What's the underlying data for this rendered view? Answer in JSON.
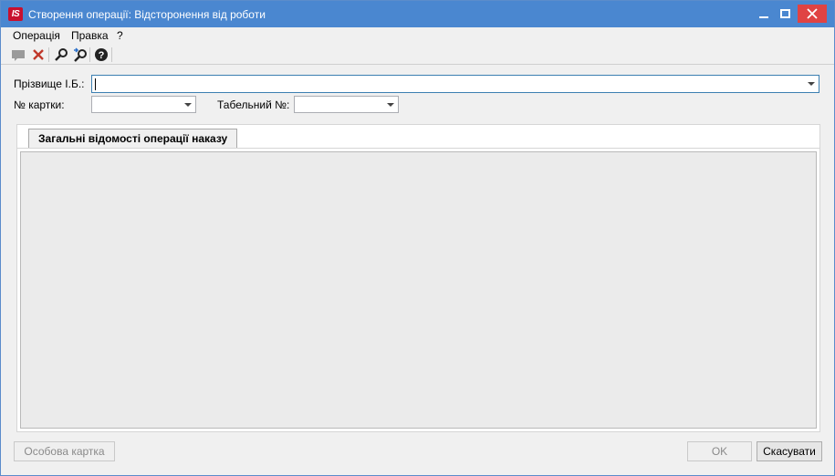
{
  "window": {
    "title": "Створення операції: Відсторонення від роботи",
    "logo_text": "IS",
    "accent_color": "#4a87d0",
    "close_color": "#e04343"
  },
  "menu": {
    "items": [
      {
        "label": "Операція"
      },
      {
        "label": "Правка"
      },
      {
        "label": "?"
      }
    ]
  },
  "toolbar": {
    "icons": [
      "message-icon",
      "delete-icon",
      "search-icon",
      "search-next-icon",
      "help-icon"
    ]
  },
  "form": {
    "name_label": "Прізвище І.Б.:",
    "name_value": "",
    "card_label": "№ картки:",
    "card_value": "",
    "tabnum_label": "Табельний №:",
    "tabnum_value": ""
  },
  "tabs": [
    {
      "label": "Загальні відомості операції наказу",
      "active": true
    }
  ],
  "buttons": {
    "personal_card": "Особова картка",
    "ok": "OK",
    "cancel": "Скасувати"
  }
}
